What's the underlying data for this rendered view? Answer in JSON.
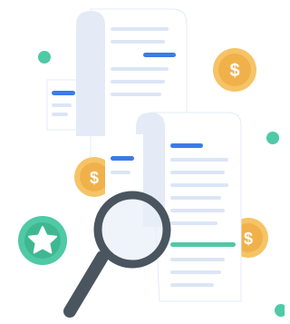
{
  "illustration": {
    "subject": "invoice-review-with-magnifying-glass",
    "elements": [
      "long-receipt-back",
      "long-receipt-front",
      "gold-coins-with-dollar-sign",
      "star-badge",
      "magnifying-glass",
      "decorative-dots"
    ]
  },
  "colors": {
    "paper": "#ffffff",
    "paper_shadow": "#e4ebf7",
    "paper_line": "#dbe6f6",
    "accent_blue": "#3b7be8",
    "accent_teal": "#4fc9a6",
    "coin_outer": "#f6c366",
    "coin_inner": "#f0b14b",
    "coin_symbol": "#ffffff",
    "star_badge": "#4fc9a6",
    "magnifier_ring": "#4a5560",
    "magnifier_glass": "#e9eff8"
  },
  "coin_symbol": "$",
  "icons": {
    "coin": "dollar-coin-icon",
    "badge": "star-badge-icon",
    "magnifier": "magnifying-glass-icon"
  }
}
